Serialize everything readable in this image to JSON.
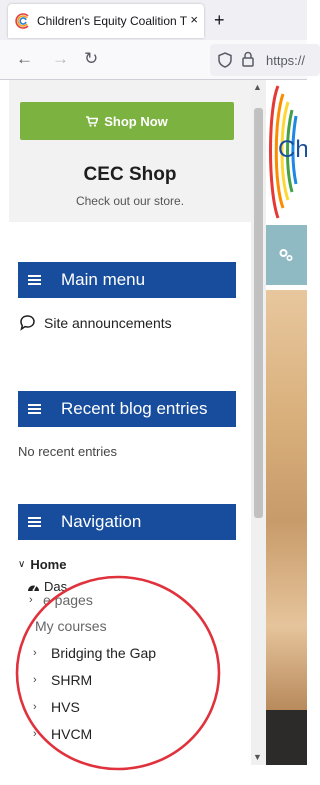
{
  "browser": {
    "tab_title": "Children's Equity Coalition Train",
    "close_glyph": "×",
    "new_tab_glyph": "+",
    "back_glyph": "←",
    "forward_glyph": "→",
    "reload_glyph": "↻",
    "url": "https://"
  },
  "shop": {
    "button_label": "Shop Now",
    "title": "CEC Shop",
    "subtitle": "Check out our store."
  },
  "main_menu": {
    "title": "Main menu",
    "items": [
      {
        "label": "Site announcements"
      }
    ]
  },
  "blog": {
    "title": "Recent blog entries",
    "empty_text": "No recent entries"
  },
  "navigation": {
    "title": "Navigation",
    "home": "Home",
    "dashboard": "Das",
    "site_pages": "e pages",
    "my_courses": "My courses",
    "courses": [
      {
        "label": "Bridging the Gap"
      },
      {
        "label": "SHRM"
      },
      {
        "label": "HVS"
      },
      {
        "label": "HVCM"
      }
    ]
  },
  "page_header": {
    "logo_text": "Ch"
  },
  "colors": {
    "block_header": "#174d9c",
    "shop_button": "#7cb23f",
    "annotation": "#e0323c"
  }
}
